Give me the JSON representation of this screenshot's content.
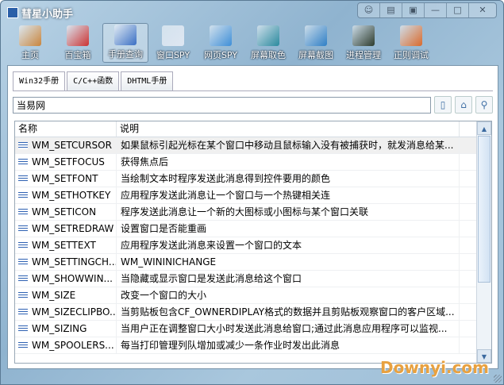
{
  "app": {
    "title": "彗星小助手",
    "window_buttons": [
      "skin",
      "menu",
      "mini",
      "minimize",
      "maximize",
      "close"
    ]
  },
  "toolbar": [
    {
      "label": "主页",
      "icon": "home-icon",
      "color": "#c9853d"
    },
    {
      "label": "百宝箱",
      "icon": "cubes-icon",
      "color": "#cc3333"
    },
    {
      "label": "手册查询",
      "icon": "help-book-icon",
      "color": "#3a6fc4"
    },
    {
      "label": "窗口SPY",
      "icon": "window-target-icon",
      "color": "#dfe7f2"
    },
    {
      "label": "网页SPY",
      "icon": "globe-target-icon",
      "color": "#3f8fd8"
    },
    {
      "label": "屏幕取色",
      "icon": "monitor-picker-icon",
      "color": "#2b8a9e"
    },
    {
      "label": "屏幕截图",
      "icon": "monitor-scissors-icon",
      "color": "#2f7fc6"
    },
    {
      "label": "进程管理",
      "icon": "process-gear-icon",
      "color": "#2c3b2c"
    },
    {
      "label": "正则调试",
      "icon": "regex-icon",
      "color": "#d96a2c"
    }
  ],
  "active_tool": 2,
  "tabs": [
    "Win32手册",
    "C/C++函数",
    "DHTML手册"
  ],
  "active_tab": 0,
  "search": {
    "value": "当易网"
  },
  "list": {
    "columns": [
      "名称",
      "说明"
    ],
    "rows": [
      [
        "WM_SETCURSOR",
        "如果鼠标引起光标在某个窗口中移动且鼠标输入没有被捕获时，就发消息给某..."
      ],
      [
        "WM_SETFOCUS",
        "获得焦点后"
      ],
      [
        "WM_SETFONT",
        "当绘制文本时程序发送此消息得到控件要用的颜色"
      ],
      [
        "WM_SETHOTKEY",
        "应用程序发送此消息让一个窗口与一个热键相关连"
      ],
      [
        "WM_SETICON",
        "程序发送此消息让一个新的大图标或小图标与某个窗口关联"
      ],
      [
        "WM_SETREDRAW",
        "设置窗口是否能重画"
      ],
      [
        "WM_SETTEXT",
        "应用程序发送此消息来设置一个窗口的文本"
      ],
      [
        "WM_SETTINGCH...",
        "WM_WININICHANGE"
      ],
      [
        "WM_SHOWWIN...",
        "当隐藏或显示窗口是发送此消息给这个窗口"
      ],
      [
        "WM_SIZE",
        "改变一个窗口的大小"
      ],
      [
        "WM_SIZECLIPBO...",
        "当剪贴板包含CF_OWNERDIPLAY格式的数据并且剪贴板观察窗口的客户区域..."
      ],
      [
        "WM_SIZING",
        "当用户正在调整窗口大小时发送此消息给窗口;通过此消息应用程序可以监视..."
      ],
      [
        "WM_SPOOLERS...",
        "每当打印管理列队增加或减少一条作业时发出此消息"
      ]
    ]
  },
  "watermark": "Downyi.com"
}
